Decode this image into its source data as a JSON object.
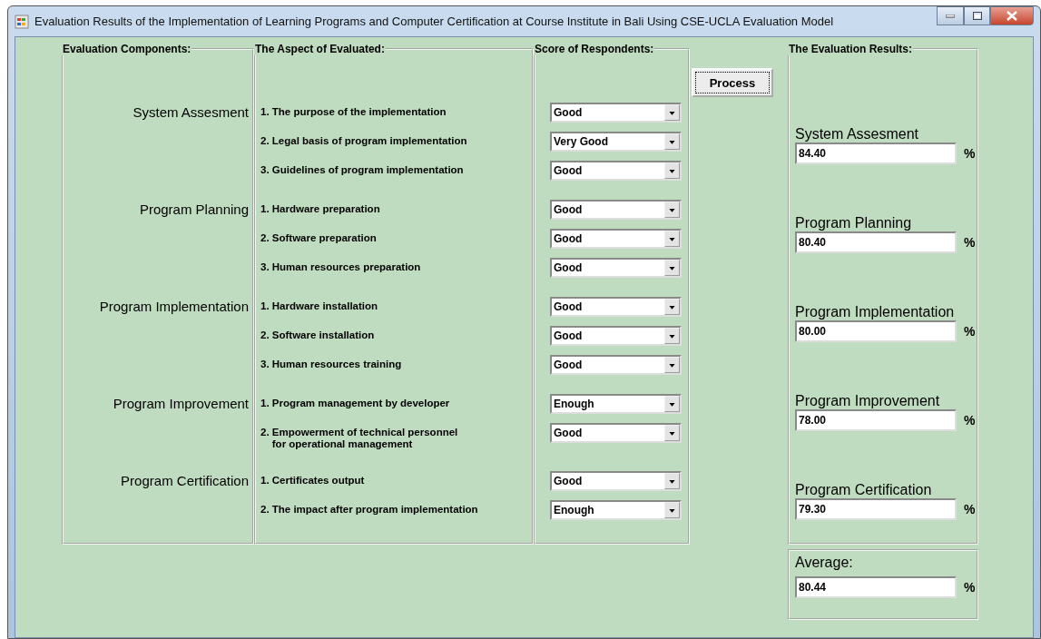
{
  "window": {
    "title": "Evaluation Results of the Implementation of Learning Programs and Computer Certification at Course Institute in Bali Using CSE-UCLA Evaluation Model"
  },
  "headings": {
    "components": "Evaluation Components:",
    "aspects": "The Aspect of Evaluated:",
    "scores": "Score of Respondents:"
  },
  "components": [
    {
      "name": "System Assesment",
      "aspects": [
        {
          "text": "1. The purpose of the implementation",
          "score": "Good"
        },
        {
          "text": "2. Legal basis of program implementation",
          "score": "Very Good"
        },
        {
          "text": "3. Guidelines of program implementation",
          "score": "Good"
        }
      ]
    },
    {
      "name": "Program Planning",
      "aspects": [
        {
          "text": "1. Hardware preparation",
          "score": "Good"
        },
        {
          "text": "2. Software preparation",
          "score": "Good"
        },
        {
          "text": "3. Human resources preparation",
          "score": "Good"
        }
      ]
    },
    {
      "name": "Program Implementation",
      "aspects": [
        {
          "text": "1. Hardware installation",
          "score": "Good"
        },
        {
          "text": "2. Software installation",
          "score": "Good"
        },
        {
          "text": "3. Human resources training",
          "score": "Good"
        }
      ]
    },
    {
      "name": "Program Improvement",
      "aspects": [
        {
          "text": "1. Program management by developer",
          "score": "Enough"
        },
        {
          "text": "2. Empowerment of technical personnel\n    for operational management",
          "score": "Good"
        }
      ]
    },
    {
      "name": "Program Certification",
      "aspects": [
        {
          "text": "1. Certificates output",
          "score": "Good"
        },
        {
          "text": "2. The impact after program implementation",
          "score": "Enough"
        }
      ]
    }
  ],
  "process_button": "Process",
  "results": {
    "title": "The Evaluation Results:",
    "items": [
      {
        "label": "System Assesment",
        "value": "84.40",
        "unit": "%"
      },
      {
        "label": "Program Planning",
        "value": "80.40",
        "unit": "%"
      },
      {
        "label": "Program Implementation",
        "value": "80.00",
        "unit": "%"
      },
      {
        "label": "Program Improvement",
        "value": "78.00",
        "unit": "%"
      },
      {
        "label": "Program Certification",
        "value": "79.30",
        "unit": "%"
      }
    ]
  },
  "average": {
    "label": "Average:",
    "value": "80.44",
    "unit": "%"
  }
}
